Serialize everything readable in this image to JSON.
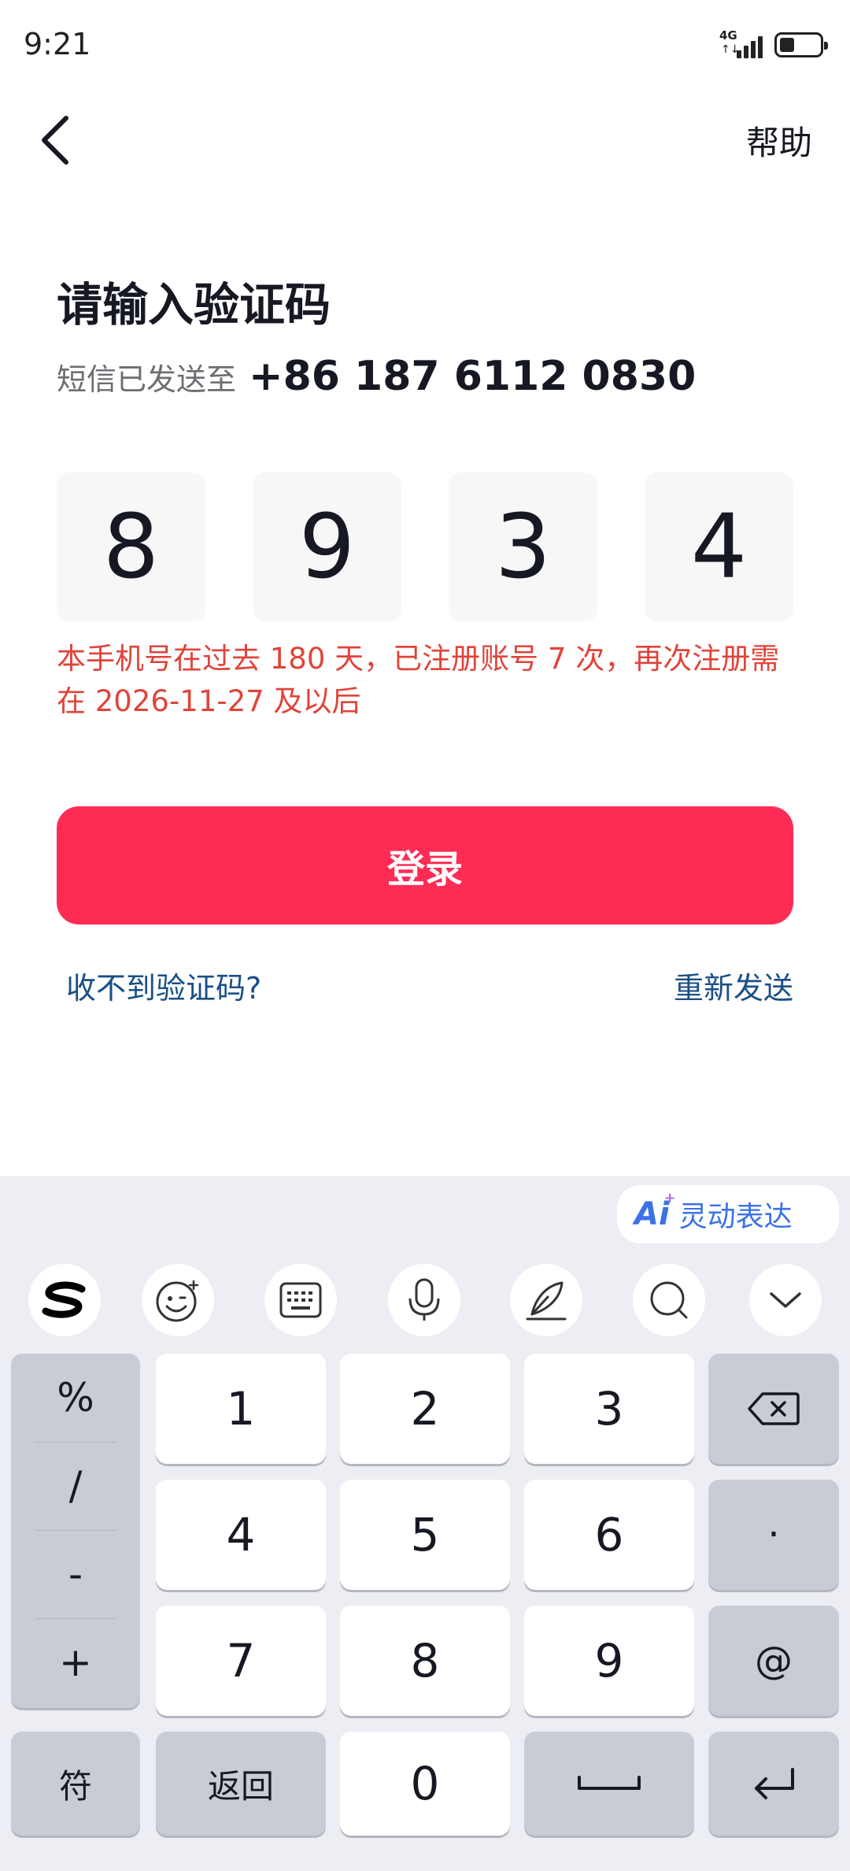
{
  "status_bar": {
    "time": "9:21",
    "network": "4G",
    "network_arrows": "↑↓"
  },
  "nav": {
    "help": "帮助"
  },
  "page": {
    "title": "请输入验证码",
    "sent_label": "短信已发送至",
    "phone": "+86 187 6112 0830",
    "code_digits": [
      "8",
      "9",
      "3",
      "4"
    ],
    "warning": "本手机号在过去 180 天，已注册账号 7 次，再次注册需在 2026-11-27 及以后",
    "login_button": "登录",
    "no_code_link": "收不到验证码?",
    "resend_link": "重新发送"
  },
  "colors": {
    "primary": "#fe2c55",
    "warning": "#e0443a",
    "link": "#1a4f85",
    "ai": "#3b72e6"
  },
  "keyboard": {
    "ai_logo": "Ai",
    "ai_label": "灵动表达",
    "toolbar_icons": [
      "sogou-logo-icon",
      "emoji-icon",
      "keyboard-icon",
      "microphone-icon",
      "handwriting-icon",
      "search-icon",
      "collapse-keyboard-icon"
    ],
    "symbols": [
      "%",
      "/",
      "-",
      "+"
    ],
    "keys": {
      "k1": "1",
      "k2": "2",
      "k3": "3",
      "k4": "4",
      "k5": "5",
      "k6": "6",
      "k7": "7",
      "k8": "8",
      "k9": "9",
      "k0": "0",
      "dot": "·",
      "at": "@",
      "symbols_key": "符",
      "back_key": "返回"
    }
  }
}
